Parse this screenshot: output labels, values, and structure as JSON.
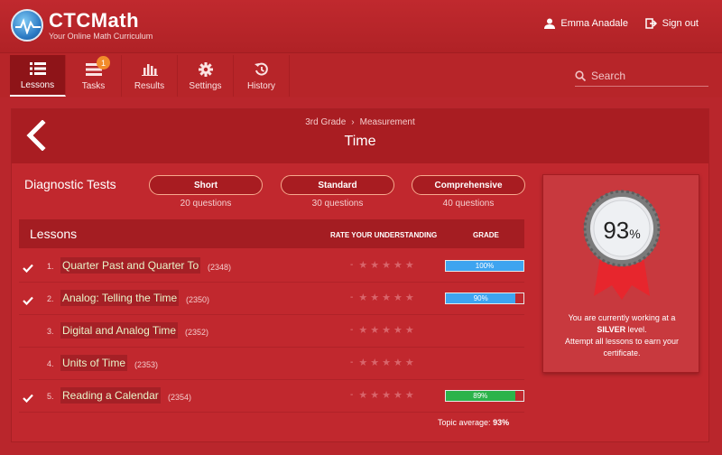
{
  "brand": {
    "name": "CTCMath",
    "tagline": "Your Online Math Curriculum"
  },
  "user": {
    "name": "Emma Anadale",
    "signout": "Sign out"
  },
  "nav": {
    "tabs": [
      {
        "label": "Lessons",
        "icon": "list-icon"
      },
      {
        "label": "Tasks",
        "icon": "tasks-icon",
        "badge": "1"
      },
      {
        "label": "Results",
        "icon": "bar-chart-icon"
      },
      {
        "label": "Settings",
        "icon": "gear-icon"
      },
      {
        "label": "History",
        "icon": "history-icon"
      }
    ],
    "search_placeholder": "Search"
  },
  "topic": {
    "grade": "3rd Grade",
    "subject": "Measurement",
    "title": "Time"
  },
  "diagnostic": {
    "label": "Diagnostic Tests",
    "tests": [
      {
        "label": "Short",
        "questions": "20 questions"
      },
      {
        "label": "Standard",
        "questions": "30 questions"
      },
      {
        "label": "Comprehensive",
        "questions": "40 questions"
      }
    ]
  },
  "lessons": {
    "title": "Lessons",
    "rate_header": "RATE YOUR UNDERSTANDING",
    "grade_header": "GRADE",
    "items": [
      {
        "num": "1.",
        "name": "Quarter Past and Quarter To",
        "code": "(2348)",
        "done": true,
        "grade": 100,
        "grade_label": "100%",
        "bar_color": "#3ea4f0"
      },
      {
        "num": "2.",
        "name": "Analog: Telling the Time",
        "code": "(2350)",
        "done": true,
        "grade": 90,
        "grade_label": "90%",
        "bar_color": "#3ea4f0"
      },
      {
        "num": "3.",
        "name": "Digital and Analog Time",
        "code": "(2352)",
        "done": false
      },
      {
        "num": "4.",
        "name": "Units of Time",
        "code": "(2353)",
        "done": false
      },
      {
        "num": "5.",
        "name": "Reading a Calendar",
        "code": "(2354)",
        "done": true,
        "grade": 89,
        "grade_label": "89%",
        "bar_color": "#2bb34a"
      }
    ],
    "rate_dash": "-",
    "topic_average_label": "Topic average:",
    "topic_average": "93%"
  },
  "certificate": {
    "percent": "93",
    "percent_sign": "%",
    "msg1": "You are currently working at a",
    "level": "SILVER",
    "msg2": "level.",
    "msg3": "Attempt all lessons to earn your certificate."
  }
}
